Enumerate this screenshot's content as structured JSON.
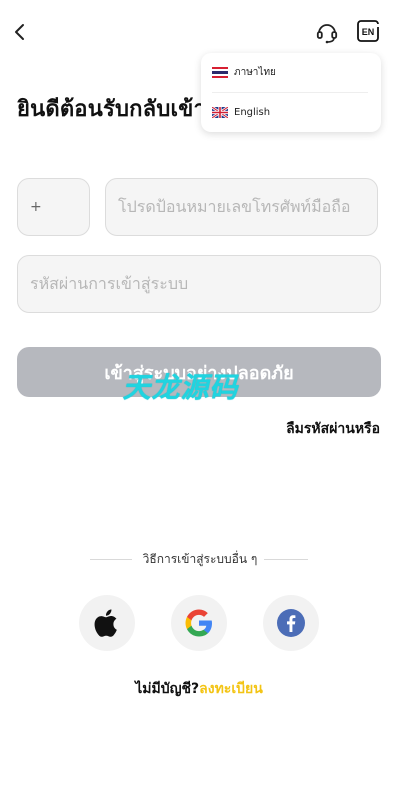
{
  "header": {
    "language_badge": "EN"
  },
  "welcome": {
    "title": "ยินดีต้อนรับกลับเข้าสู่ระบบ"
  },
  "form": {
    "country_code": "+",
    "phone_placeholder": "โปรดป้อนหมายเลขโทรศัพท์มือถือ",
    "password_placeholder": "รหัสผ่านการเข้าสู่ระบบ",
    "login_button": "เข้าสู่ระบบอย่างปลอดภัย",
    "forgot_password": "ลืมรหัสผ่านหรือ"
  },
  "watermark": {
    "text": "天龙源码"
  },
  "social": {
    "divider_text": "วิธีการเข้าสู่ระบบอื่น ๆ",
    "providers": [
      "apple",
      "google",
      "facebook"
    ]
  },
  "signup": {
    "prompt": "ไม่มีบัญชี?",
    "link": "ลงทะเบียน"
  },
  "language_menu": {
    "items": [
      {
        "label": "ภาษาไทย"
      },
      {
        "label": "English"
      }
    ]
  },
  "colors": {
    "accent_yellow": "#f3c414",
    "button_gray": "#b6b8be",
    "watermark_cyan": "#20d4e0",
    "facebook_blue": "#4c6db7"
  },
  "icons": {
    "back": "chevron-left-icon",
    "support": "headset-icon",
    "language": "language-badge-icon",
    "apple": "apple-icon",
    "google": "google-icon",
    "facebook": "facebook-icon"
  }
}
